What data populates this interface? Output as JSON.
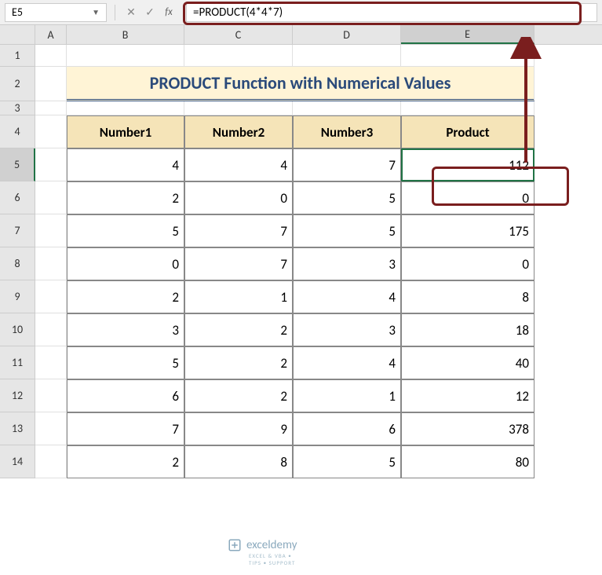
{
  "namebox": {
    "value": "E5"
  },
  "formula": {
    "text": "=PRODUCT(4*4*7)"
  },
  "columns": [
    "A",
    "B",
    "C",
    "D",
    "E"
  ],
  "row_numbers": [
    "1",
    "2",
    "3",
    "4",
    "5",
    "6",
    "7",
    "8",
    "9",
    "10",
    "11",
    "12",
    "13",
    "14"
  ],
  "title": "PRODUCT Function with Numerical Values",
  "headers": {
    "b": "Number1",
    "c": "Number2",
    "d": "Number3",
    "e": "Product"
  },
  "rows": [
    {
      "b": "4",
      "c": "4",
      "d": "7",
      "e": "112"
    },
    {
      "b": "2",
      "c": "0",
      "d": "5",
      "e": "0"
    },
    {
      "b": "5",
      "c": "7",
      "d": "5",
      "e": "175"
    },
    {
      "b": "0",
      "c": "7",
      "d": "3",
      "e": "0"
    },
    {
      "b": "2",
      "c": "1",
      "d": "4",
      "e": "8"
    },
    {
      "b": "3",
      "c": "2",
      "d": "3",
      "e": "18"
    },
    {
      "b": "5",
      "c": "2",
      "d": "4",
      "e": "40"
    },
    {
      "b": "6",
      "c": "2",
      "d": "1",
      "e": "12"
    },
    {
      "b": "7",
      "c": "9",
      "d": "6",
      "e": "378"
    },
    {
      "b": "2",
      "c": "8",
      "d": "5",
      "e": "80"
    }
  ],
  "watermark": {
    "brand": "exceldemy",
    "tag": "EXCEL & VBA • TIPS • SUPPORT"
  }
}
